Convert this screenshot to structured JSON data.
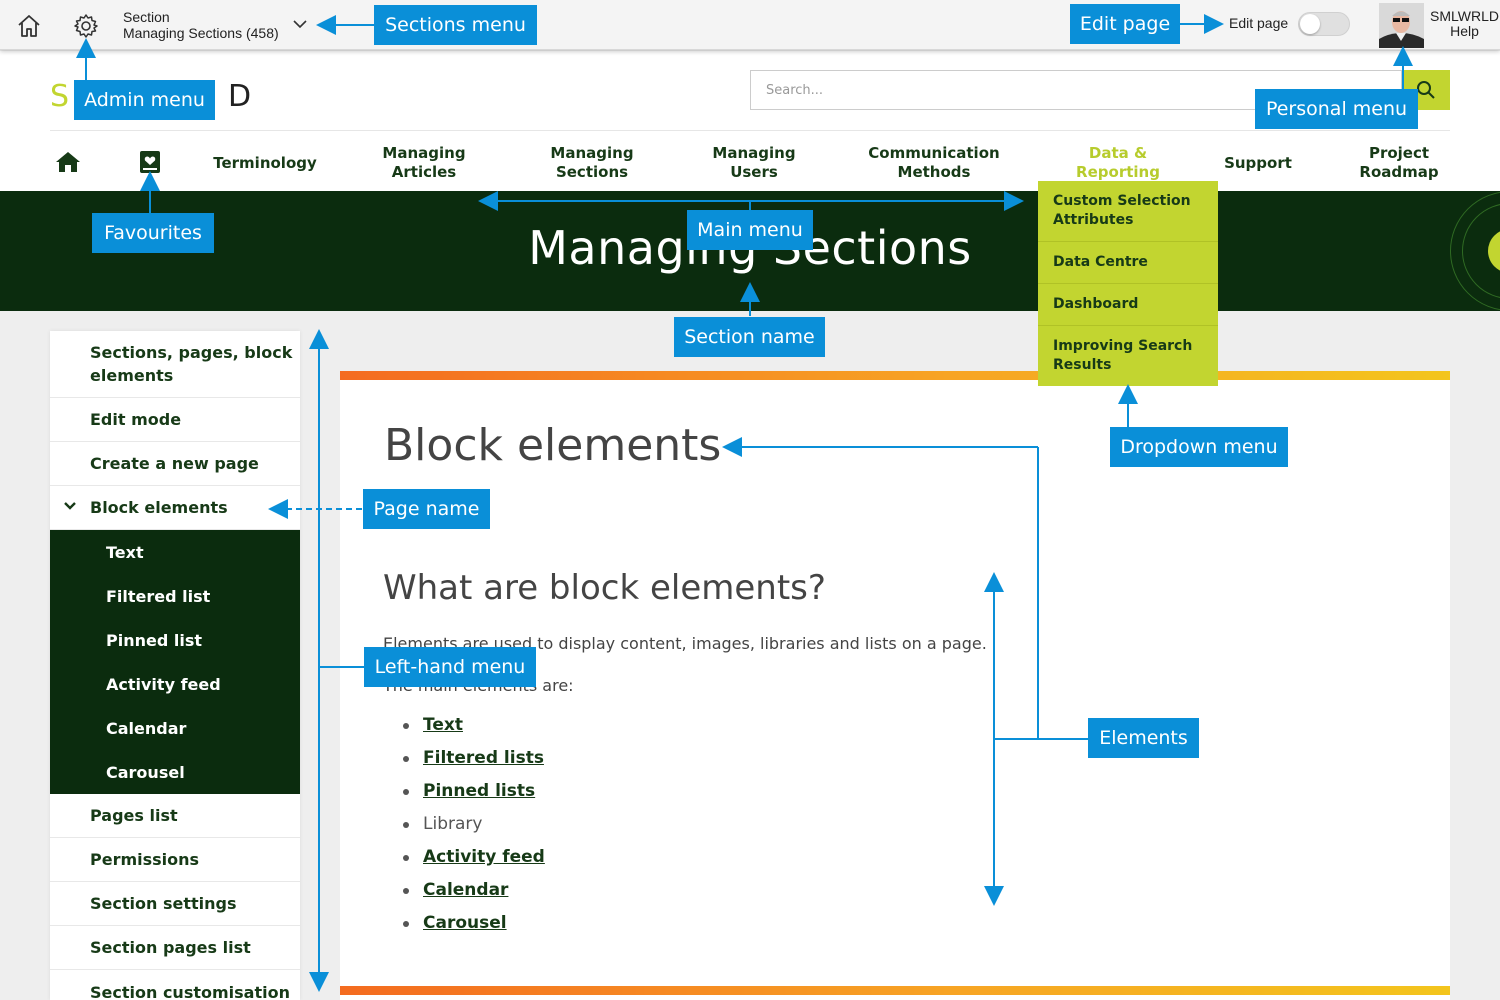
{
  "admin_bar": {
    "section_label": "Section",
    "section_value": "Managing Sections (458)",
    "edit_page_label": "Edit page",
    "edit_page_enabled": false,
    "user_name": "SMLWRLD",
    "help_label": "Help"
  },
  "header": {
    "logo_text": "S",
    "logo_end": "D",
    "search_placeholder": "Search..."
  },
  "main_nav": {
    "items": [
      {
        "label": "Terminology"
      },
      {
        "label": "Managing Articles"
      },
      {
        "label": "Managing Sections"
      },
      {
        "label": "Managing Users"
      },
      {
        "label": "Communication Methods"
      },
      {
        "label": "Data & Reporting",
        "active": true
      },
      {
        "label": "Support"
      },
      {
        "label": "Project Roadmap"
      }
    ]
  },
  "banner": {
    "title": "Managing Sections"
  },
  "dropdown": {
    "items": [
      {
        "label": "Custom Selection Attributes"
      },
      {
        "label": "Data Centre"
      },
      {
        "label": "Dashboard"
      },
      {
        "label": "Improving Search Results"
      }
    ]
  },
  "left_menu": {
    "items": [
      {
        "label": "Sections, pages, block elements"
      },
      {
        "label": "Edit mode"
      },
      {
        "label": "Create a new page"
      },
      {
        "label": "Block elements",
        "expanded": true
      },
      {
        "label": "Pages list"
      },
      {
        "label": "Permissions"
      },
      {
        "label": "Section settings"
      },
      {
        "label": "Section pages list"
      },
      {
        "label": "Section customisation"
      }
    ],
    "sub_items": [
      {
        "label": "Text"
      },
      {
        "label": "Filtered list"
      },
      {
        "label": "Pinned list"
      },
      {
        "label": "Activity feed"
      },
      {
        "label": "Calendar"
      },
      {
        "label": "Carousel"
      }
    ]
  },
  "content": {
    "page_title": "Block elements",
    "subtitle": "What are block elements?",
    "para1": "Elements are used to display content, images, libraries and lists on a page.",
    "para2": "The main elements are:",
    "list": [
      {
        "label": "Text",
        "link": true
      },
      {
        "label": "Filtered lists",
        "link": true
      },
      {
        "label": "Pinned lists",
        "link": true
      },
      {
        "label": "Library",
        "link": false
      },
      {
        "label": "Activity feed",
        "link": true
      },
      {
        "label": "Calendar",
        "link": true
      },
      {
        "label": "Carousel",
        "link": true
      }
    ]
  },
  "annotations": {
    "sections_menu": "Sections menu",
    "edit_page": "Edit page",
    "admin_menu": "Admin menu",
    "personal_menu": "Personal menu",
    "favourites": "Favourites",
    "main_menu": "Main menu",
    "section_name": "Section name",
    "dropdown_menu": "Dropdown menu",
    "page_name": "Page name",
    "left_hand_menu": "Left-hand menu",
    "elements": "Elements"
  },
  "colors": {
    "brand_dark_green": "#0b2c0e",
    "brand_lime": "#c2d530",
    "callout_blue": "#0a8fd8",
    "accent_orange": "#f46b20"
  }
}
